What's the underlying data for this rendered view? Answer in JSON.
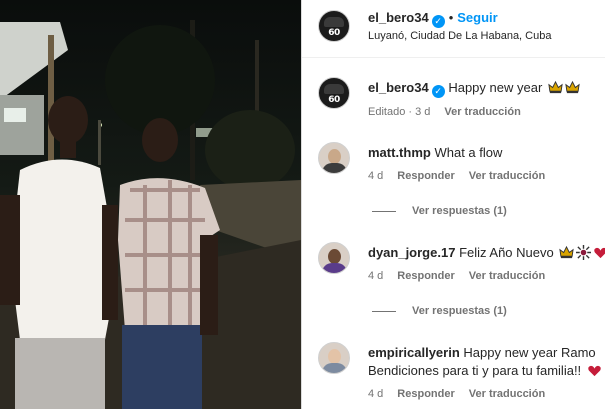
{
  "post": {
    "author": "el_bero34",
    "follow_label": "Seguir",
    "separator": "•",
    "location": "Luyanó, Ciudad De La Habana, Cuba",
    "caption": "Happy new year",
    "caption_emoji": [
      "crown-emoji",
      "crown-emoji"
    ],
    "edited_label": "Editado · 3 d",
    "translate_label": "Ver traducción",
    "avatar_number": "60"
  },
  "comments": [
    {
      "username": "matt.thmp",
      "text": "What a flow",
      "time": "4 d",
      "reply_label": "Responder",
      "translate_label": "Ver traducción",
      "replies_label": "Ver respuestas (1)"
    },
    {
      "username": "dyan_jorge.17",
      "text": "Feliz Año Nuevo",
      "time": "4 d",
      "reply_label": "Responder",
      "translate_label": "Ver traducción",
      "replies_label": "Ver respuestas (1)"
    },
    {
      "username": "empiricallyerin",
      "text": "Happy new year Ramo",
      "text_line2": "Bendiciones para ti y para tu familia!!",
      "time": "4 d",
      "reply_label": "Responder",
      "translate_label": "Ver traducción"
    }
  ],
  "colors": {
    "accent": "#0095f6",
    "secondary_text": "#737373",
    "primary_text": "#262626"
  }
}
